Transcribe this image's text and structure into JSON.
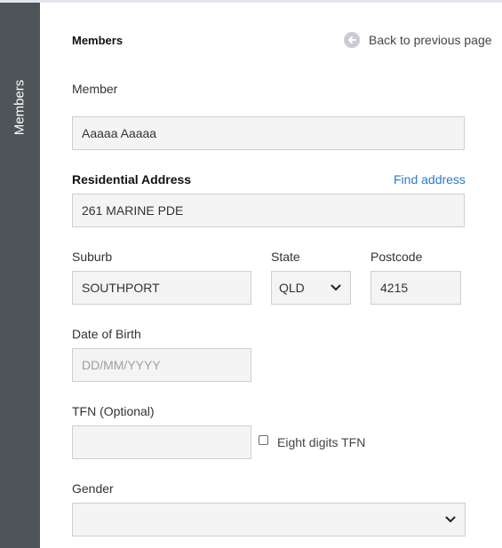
{
  "sidebar": {
    "label": "Members"
  },
  "header": {
    "title": "Members",
    "back_label": "Back to previous page"
  },
  "form": {
    "member": {
      "label": "Member",
      "value": "Aaaaa Aaaaa"
    },
    "address": {
      "label": "Residential Address",
      "find_label": "Find address",
      "value": "261 MARINE PDE"
    },
    "suburb": {
      "label": "Suburb",
      "value": "SOUTHPORT"
    },
    "state": {
      "label": "State",
      "value": "QLD"
    },
    "postcode": {
      "label": "Postcode",
      "value": "4215"
    },
    "dob": {
      "label": "Date of Birth",
      "placeholder": "DD/MM/YYYY"
    },
    "tfn": {
      "label": "TFN (Optional)",
      "value": "",
      "checkbox_label": "Eight digits TFN",
      "checkbox_checked": false
    },
    "gender": {
      "label": "Gender",
      "value": ""
    }
  },
  "icons": {
    "back": "arrow-left-circle-icon",
    "dropdown": "chevron-down-icon"
  },
  "colors": {
    "sidebar": "#4e5458",
    "link": "#2b7bc4",
    "field_bg": "#f4f4f4"
  }
}
